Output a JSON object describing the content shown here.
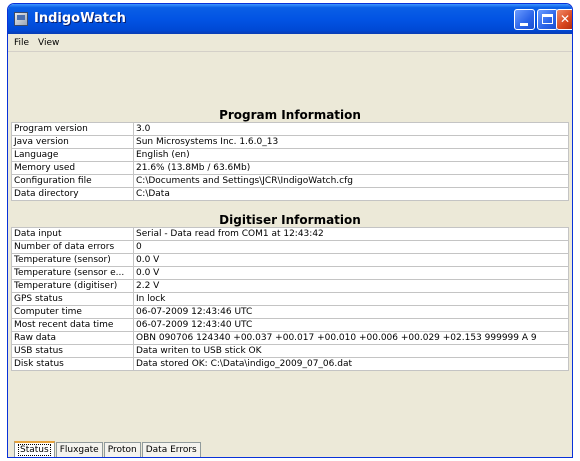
{
  "window": {
    "title": "IndigoWatch"
  },
  "menu": {
    "file": "File",
    "view": "View"
  },
  "program": {
    "heading": "Program Information",
    "rows": [
      {
        "key": "Program version",
        "value": "3.0"
      },
      {
        "key": "Java version",
        "value": "Sun Microsystems Inc. 1.6.0_13"
      },
      {
        "key": "Language",
        "value": "English (en)"
      },
      {
        "key": "Memory used",
        "value": "21.6% (13.8Mb / 63.6Mb)"
      },
      {
        "key": "Configuration file",
        "value": "C:\\Documents and Settings\\JCR\\IndigoWatch.cfg"
      },
      {
        "key": "Data directory",
        "value": "C:\\Data"
      }
    ]
  },
  "digitiser": {
    "heading": "Digitiser Information",
    "rows": [
      {
        "key": "Data input",
        "value": "Serial - Data read from COM1 at 12:43:42"
      },
      {
        "key": "Number of data errors",
        "value": "0"
      },
      {
        "key": "Temperature (sensor)",
        "value": "0.0 V"
      },
      {
        "key": "Temperature (sensor e...",
        "value": "0.0 V"
      },
      {
        "key": "Temperature (digitiser)",
        "value": "2.2 V"
      },
      {
        "key": "GPS status",
        "value": "In lock"
      },
      {
        "key": "Computer time",
        "value": "06-07-2009 12:43:46 UTC"
      },
      {
        "key": "Most recent data time",
        "value": "06-07-2009 12:43:40 UTC"
      },
      {
        "key": "Raw data",
        "value": "OBN 090706 124340 +00.037 +00.017 +00.010 +00.006 +00.029 +02.153 999999 A 9"
      },
      {
        "key": "USB status",
        "value": "Data writen to USB stick OK"
      },
      {
        "key": "Disk status",
        "value": "Data stored OK: C:\\Data\\indigo_2009_07_06.dat"
      }
    ]
  },
  "tabs": [
    {
      "label": "Status",
      "active": true
    },
    {
      "label": "Fluxgate",
      "active": false
    },
    {
      "label": "Proton",
      "active": false
    },
    {
      "label": "Data Errors",
      "active": false
    }
  ]
}
